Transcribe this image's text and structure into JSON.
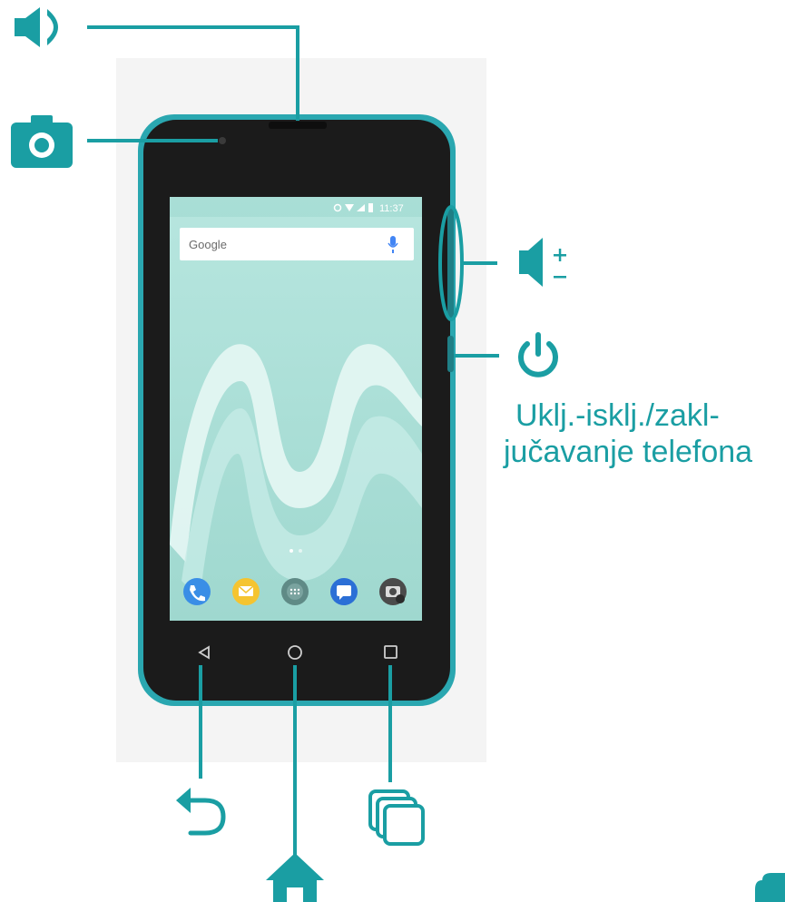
{
  "colors": {
    "accent": "#1a9ea3",
    "phone_body": "#1b1b1b",
    "phone_frame": "#2aa7b0",
    "screen_bg": "#a9ded6",
    "wallpaper_curve": "#d9f1ee"
  },
  "phone": {
    "status_bar": {
      "time": "11:37"
    },
    "search_bar": {
      "logo_text": "Google"
    },
    "dock_icons": [
      "phone-icon",
      "messages-icon",
      "app-drawer-icon",
      "chat-icon",
      "camera-icon"
    ],
    "nav_icons": [
      "back-icon",
      "home-icon",
      "recents-icon"
    ]
  },
  "callouts": {
    "power_label_line1": "Uklj.-isklj./zakl-",
    "power_label_line2": "jučavanje telefona",
    "icons": [
      "speaker-icon",
      "camera-icon",
      "volume-icon",
      "power-icon",
      "back-icon",
      "home-icon",
      "recents-icon"
    ]
  }
}
